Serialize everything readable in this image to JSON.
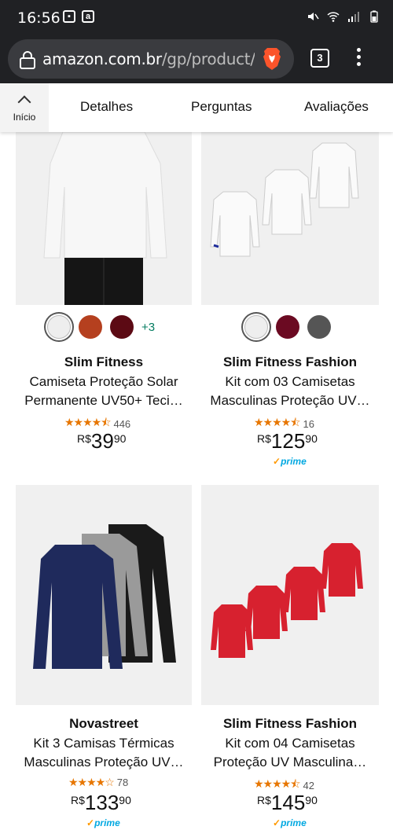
{
  "status": {
    "time": "16:56"
  },
  "browser": {
    "url_host": "amazon.com.br",
    "url_path": "/gp/product/B",
    "tab_count": "3"
  },
  "subnav": {
    "home_label": "Início",
    "items": [
      "Detalhes",
      "Perguntas",
      "Avaliações"
    ]
  },
  "products": [
    {
      "brand": "Slim Fitness",
      "title_line1": "Camiseta Proteção Solar",
      "title_line2": "Permanente UV50+ Teci…",
      "rating": 4.5,
      "reviews": "446",
      "currency": "R$",
      "price_whole": "39",
      "price_fraction": "90",
      "prime": "",
      "swatch_colors": [
        "#eeeeee",
        "#b5401f",
        "#5c0a14"
      ],
      "more_colors": "+3"
    },
    {
      "brand": "Slim Fitness Fashion",
      "title_line1": "Kit com 03 Camisetas",
      "title_line2": "Masculinas Proteção UV…",
      "rating": 4.5,
      "reviews": "16",
      "currency": "R$",
      "price_whole": "125",
      "price_fraction": "90",
      "prime": "prime",
      "swatch_colors": [
        "#eeeeee",
        "#6b0a22",
        "#555555"
      ],
      "more_colors": ""
    },
    {
      "brand": "Novastreet",
      "title_line1": "Kit 3 Camisas Térmicas",
      "title_line2": "Masculinas Proteção UV…",
      "rating": 4.0,
      "reviews": "78",
      "currency": "R$",
      "price_whole": "133",
      "price_fraction": "90",
      "prime": "prime"
    },
    {
      "brand": "Slim Fitness Fashion",
      "title_line1": "Kit com 04 Camisetas",
      "title_line2": "Proteção UV Masculina…",
      "rating": 4.5,
      "reviews": "42",
      "currency": "R$",
      "price_whole": "145",
      "price_fraction": "90",
      "prime": "prime"
    }
  ],
  "colors": {
    "status_bg": "#202124",
    "star": "#e77600",
    "prime_blue": "#00a8e1"
  }
}
